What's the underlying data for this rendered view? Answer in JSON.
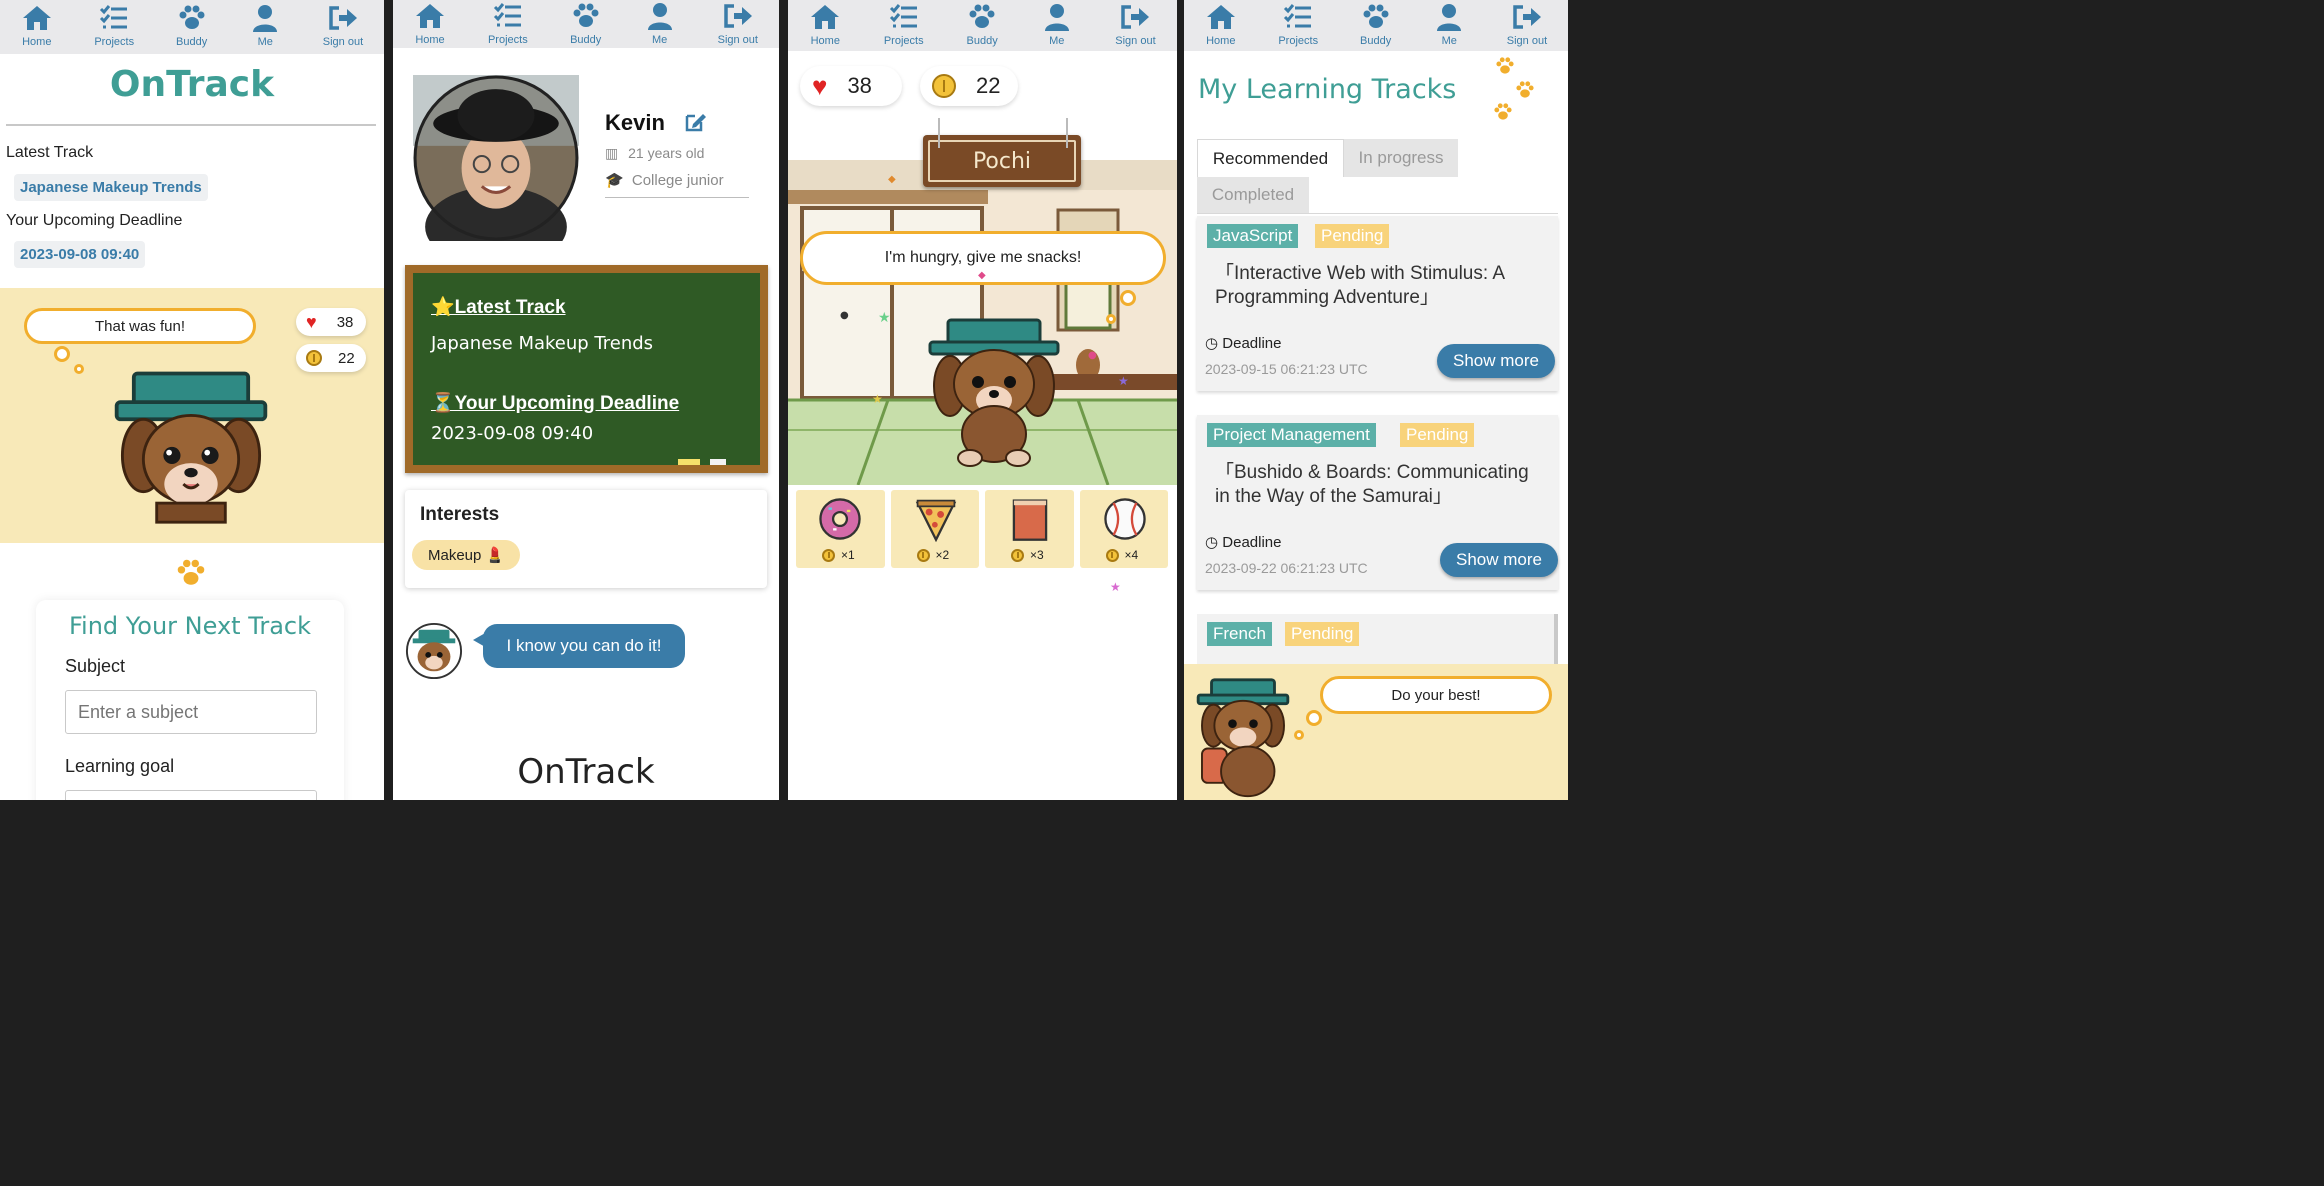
{
  "nav": {
    "home": "Home",
    "projects": "Projects",
    "buddy": "Buddy",
    "me": "Me",
    "signout": "Sign out"
  },
  "home": {
    "app_title": "OnTrack",
    "latest_track_label": "Latest Track",
    "latest_track_value": "Japanese Makeup Trends",
    "deadline_label": "Your Upcoming Deadline",
    "deadline_value": "2023-09-08 09:40",
    "speech": "That was fun!",
    "hearts": "38",
    "coins": "22",
    "find_title": "Find Your Next Track",
    "subject_label": "Subject",
    "subject_placeholder": "Enter a subject",
    "goal_label": "Learning goal"
  },
  "profile": {
    "name": "Kevin",
    "age": "21 years old",
    "grade": "College junior",
    "board_latest_label": "⭐Latest Track",
    "board_latest_value": "Japanese Makeup Trends",
    "board_deadline_label": "⏳Your Upcoming Deadline",
    "board_deadline_value": "2023-09-08 09:40",
    "interests_title": "Interests",
    "interest_tag": "Makeup 💄",
    "buddy_message": "I know you can do it!",
    "footer_logo": "OnTrack"
  },
  "buddy": {
    "hearts": "38",
    "coins": "22",
    "pet_name": "Pochi",
    "speech": "I'm hungry, give me snacks!",
    "snacks": [
      {
        "name": "donut",
        "count": "×1"
      },
      {
        "name": "pizza",
        "count": "×2"
      },
      {
        "name": "tofu",
        "count": "×3"
      },
      {
        "name": "baseball",
        "count": "×4"
      }
    ]
  },
  "tracks": {
    "title": "My Learning Tracks",
    "tabs": [
      "Recommended",
      "In progress",
      "Completed"
    ],
    "deadline_label": "Deadline",
    "show_more": "Show more",
    "cards": [
      {
        "subject": "JavaScript",
        "status": "Pending",
        "title": "「Interactive Web with Stimulus: A Programming Adventure」",
        "deadline": "2023-09-15 06:21:23 UTC"
      },
      {
        "subject": "Project Management",
        "status": "Pending",
        "title": "「Bushido & Boards: Communicating in the Way of the Samurai」",
        "deadline": "2023-09-22 06:21:23 UTC"
      },
      {
        "subject": "French",
        "status": "Pending"
      }
    ],
    "speech": "Do your best!"
  },
  "colors": {
    "teal": "#3f9e95",
    "blue": "#3a7ca8",
    "cream": "#f8e9b8",
    "orange": "#f1ae2d",
    "board_green": "#2f5a25",
    "board_frame": "#a06a28",
    "subject_tag": "#5cb0a8",
    "status_tag": "#f8d37b"
  }
}
